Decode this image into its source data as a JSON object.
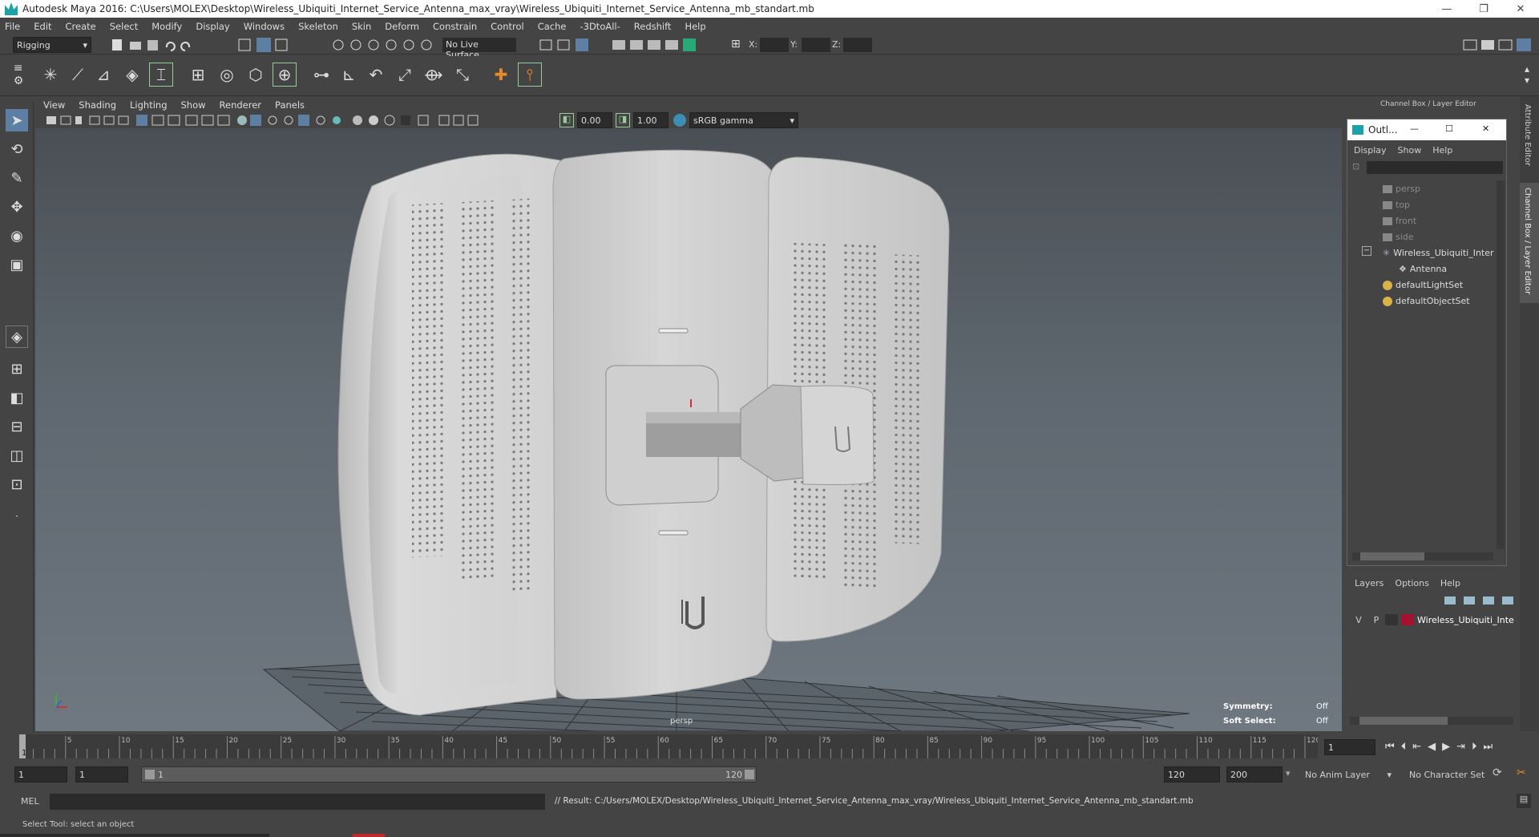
{
  "window": {
    "title": "Autodesk Maya 2016: C:\\Users\\MOLEX\\Desktop\\Wireless_Ubiquiti_Internet_Service_Antenna_max_vray\\Wireless_Ubiquiti_Internet_Service_Antenna_mb_standart.mb",
    "minimize": "—",
    "restore": "❐",
    "close": "✕"
  },
  "menu": [
    "File",
    "Edit",
    "Create",
    "Select",
    "Modify",
    "Display",
    "Windows",
    "Skeleton",
    "Skin",
    "Deform",
    "Constrain",
    "Control",
    "Cache",
    "-3DtoAll-",
    "Redshift",
    "Help"
  ],
  "toolbar": {
    "mode": "Rigging",
    "live_surface": "No Live Surface",
    "x_label": "X:",
    "y_label": "Y:",
    "z_label": "Z:"
  },
  "viewport": {
    "menu": [
      "View",
      "Shading",
      "Lighting",
      "Show",
      "Renderer",
      "Panels"
    ],
    "exposure": "0.00",
    "gamma": "1.00",
    "colorspace": "sRGB gamma",
    "camera": "persp",
    "symmetry_label": "Symmetry:",
    "symmetry_value": "Off",
    "soft_select_label": "Soft Select:",
    "soft_select_value": "Off"
  },
  "channel_box": {
    "title": "Channel Box / Layer Editor",
    "side_tab_attr": "Attribute Editor",
    "side_tab_channel": "Channel Box / Layer Editor"
  },
  "outliner": {
    "title": "Outl...",
    "menu": [
      "Display",
      "Show",
      "Help"
    ],
    "nodes": [
      {
        "label": "persp",
        "dim": true
      },
      {
        "label": "top",
        "dim": true
      },
      {
        "label": "front",
        "dim": true
      },
      {
        "label": "side",
        "dim": true
      },
      {
        "label": "Wireless_Ubiquiti_Inter",
        "dim": false
      },
      {
        "label": "Antenna",
        "dim": false
      },
      {
        "label": "defaultLightSet",
        "dim": false
      },
      {
        "label": "defaultObjectSet",
        "dim": false
      }
    ],
    "collapse_toggle": "−"
  },
  "layers": {
    "menu": [
      "Layers",
      "Options",
      "Help"
    ],
    "row": {
      "v": "V",
      "p": "P",
      "name": "Wireless_Ubiquiti_Inte",
      "color": "#a3122f"
    }
  },
  "timeline": {
    "ticks": [
      "5",
      "10",
      "15",
      "20",
      "25",
      "30",
      "35",
      "40",
      "45",
      "50",
      "55",
      "60",
      "65",
      "70",
      "75",
      "80",
      "85",
      "90",
      "95",
      "100",
      "105",
      "110",
      "115",
      "120"
    ],
    "current_marker": "1",
    "current_frame": "1"
  },
  "range": {
    "start": "1",
    "playback_start": "1",
    "slider_start": "1",
    "slider_end": "120",
    "playback_end": "120",
    "end": "200",
    "anim_layer": "No Anim Layer",
    "character_set": "No Character Set"
  },
  "command": {
    "lang": "MEL",
    "result": "// Result: C:/Users/MOLEX/Desktop/Wireless_Ubiquiti_Internet_Service_Antenna_max_vray/Wireless_Ubiquiti_Internet_Service_Antenna_mb_standart.mb"
  },
  "help_line": "Select Tool: select an object"
}
